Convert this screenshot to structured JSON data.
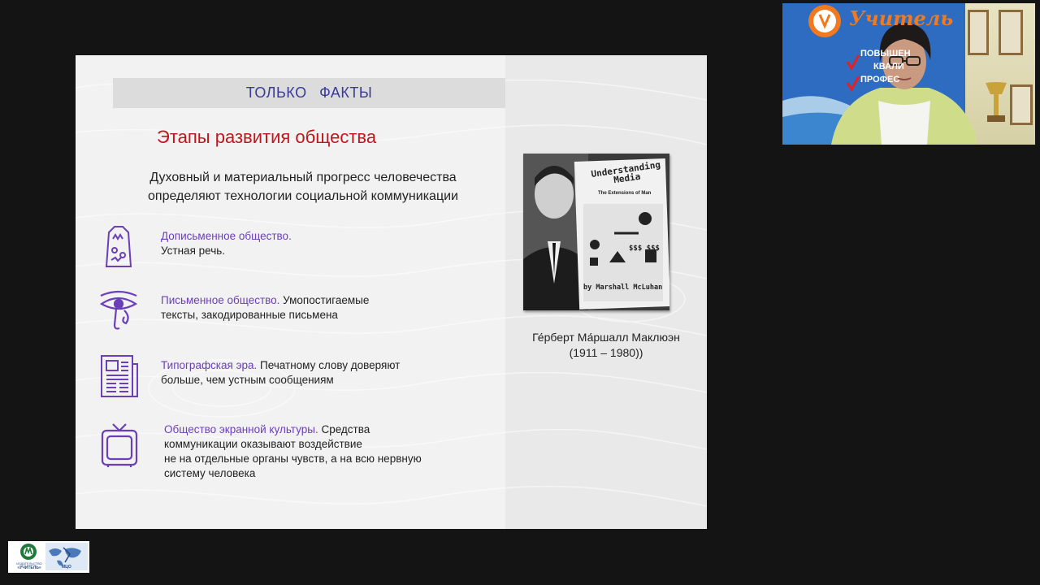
{
  "slide": {
    "banner": "ТОЛЬКО ФАКТЫ",
    "title": "Этапы развития общества",
    "subtitle_line1": "Духовный и материальный прогресс человечества",
    "subtitle_line2": "определяют технологии социальной коммуникации",
    "items": [
      {
        "highlight": "Дописьменное общество.",
        "line2": "Устная речь."
      },
      {
        "highlight": "Письменное общество.",
        "rest1": " Умопостигаемые",
        "line2": "тексты, закодированные письмена"
      },
      {
        "highlight": "Типографская эра.",
        "rest1": " Печатному слову доверяют",
        "line2": "больше, чем устным сообщениям"
      },
      {
        "highlight": "Общество экранной культуры.",
        "rest1": " Средства",
        "line2": "коммуникации оказывают воздействие",
        "line3": "не на отдельные органы чувств, а на всю нервную",
        "line4": "систему человека"
      }
    ],
    "book": {
      "title1": "Understanding",
      "title2": "Media",
      "subtitle": "The Extensions of Man",
      "author": "by Marshall McLuhan",
      "symbols": "$$$ $$$"
    },
    "caption_line1": "Ге́рберт Ма́ршалл Маклюэн",
    "caption_line2": "(1911 – 1980))"
  },
  "webcam": {
    "sign_title": "Учитель",
    "sign_line1": "ПОВЫШЕН",
    "sign_line2": "КВАЛИ",
    "sign_line3": "ПРОФЕС"
  },
  "logo": {
    "text1": "ИЗДАТЕЛЬСТВО",
    "text2": "«УЧИТЕЛЬ»",
    "text3": "МЦО"
  },
  "colors": {
    "accent_title": "#c0161d",
    "highlight": "#6b3fb8",
    "banner_text": "#3a3a9a",
    "icon": "#6b3fb8"
  }
}
